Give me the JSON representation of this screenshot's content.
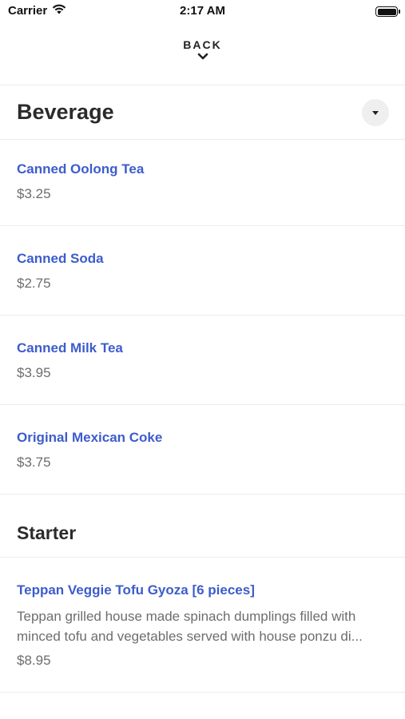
{
  "status_bar": {
    "carrier": "Carrier",
    "time": "2:17 AM"
  },
  "nav": {
    "back_label": "BACK"
  },
  "sections": [
    {
      "title": "Beverage",
      "items": [
        {
          "name": "Canned Oolong Tea",
          "price": "$3.25"
        },
        {
          "name": "Canned Soda",
          "price": "$2.75"
        },
        {
          "name": "Canned Milk Tea",
          "price": "$3.95"
        },
        {
          "name": "Original Mexican Coke",
          "price": "$3.75"
        }
      ]
    },
    {
      "title": "Starter",
      "items": [
        {
          "name": "Teppan Veggie Tofu Gyoza [6 pieces]",
          "description": "Teppan grilled house made spinach dumplings filled with minced tofu and vegetables served with house ponzu di...",
          "price": "$8.95"
        }
      ]
    }
  ],
  "colors": {
    "item_name": "#3d5ccc",
    "price_text": "#6d6d6d",
    "divider": "#ececec"
  }
}
